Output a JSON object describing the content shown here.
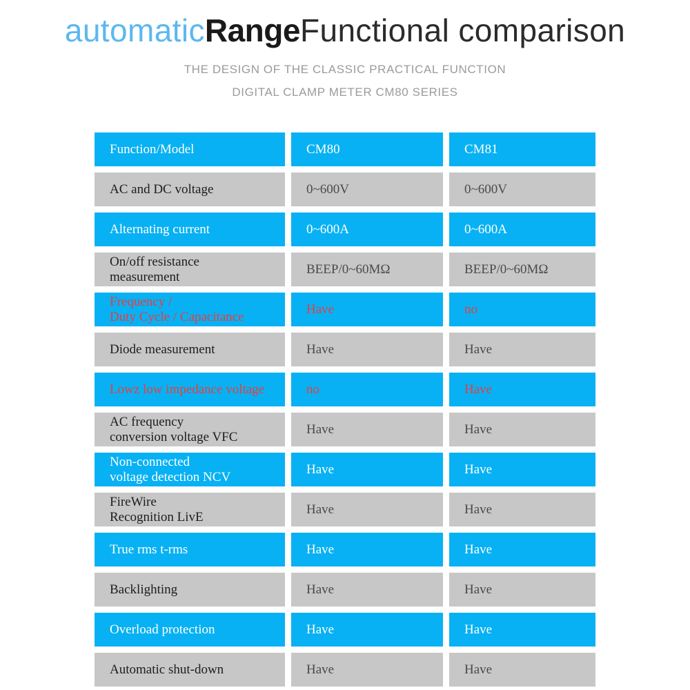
{
  "header": {
    "title_part1": "automatic",
    "title_part2": "Range",
    "title_part3": "Functional comparison",
    "subtitle_line1": "THE DESIGN OF THE CLASSIC PRACTICAL FUNCTION",
    "subtitle_line2": "DIGITAL CLAMP METER CM80 SERIES"
  },
  "colors": {
    "accent_blue": "#08b1f3",
    "title_blue": "#5bb8ef",
    "row_gray": "#c7c7c7",
    "highlight_red": "#ef3b3b",
    "subtitle_gray": "#9b9b9b"
  },
  "table": {
    "columns": [
      "Function/Model",
      "CM80",
      "CM81"
    ],
    "rows": [
      {
        "feature": "Function/Model",
        "cm80": "CM80",
        "cm81": "CM81",
        "style": "blue",
        "text": "white",
        "is_header": true
      },
      {
        "feature": "AC and DC voltage",
        "cm80": "0~600V",
        "cm81": "0~600V",
        "style": "gray",
        "text": "dark",
        "is_header": false
      },
      {
        "feature": "Alternating current",
        "cm80": "0~600A",
        "cm81": "0~600A",
        "style": "blue",
        "text": "white",
        "is_header": false
      },
      {
        "feature": "On/off resistance\nmeasurement",
        "cm80": "BEEP/0~60MΩ",
        "cm81": "BEEP/0~60MΩ",
        "style": "gray",
        "text": "dark",
        "is_header": false
      },
      {
        "feature": "Frequency /\nDuty Cycle / Capacitance",
        "cm80": "Have",
        "cm81": "no",
        "style": "blue",
        "text": "red",
        "is_header": false
      },
      {
        "feature": "Diode measurement",
        "cm80": "Have",
        "cm81": "Have",
        "style": "gray",
        "text": "dark",
        "is_header": false
      },
      {
        "feature": "Lowz low impedance voltage",
        "cm80": "no",
        "cm81": "Have",
        "style": "blue",
        "text": "red",
        "is_header": false
      },
      {
        "feature": "AC frequency\nconversion voltage VFC",
        "cm80": "Have",
        "cm81": "Have",
        "style": "gray",
        "text": "dark",
        "is_header": false
      },
      {
        "feature": "Non-connected\nvoltage detection NCV",
        "cm80": "Have",
        "cm81": "Have",
        "style": "blue",
        "text": "white",
        "is_header": false
      },
      {
        "feature": "FireWire\nRecognition LivE",
        "cm80": "Have",
        "cm81": "Have",
        "style": "gray",
        "text": "dark",
        "is_header": false
      },
      {
        "feature": "True rms t-rms",
        "cm80": "Have",
        "cm81": "Have",
        "style": "blue",
        "text": "white",
        "is_header": false
      },
      {
        "feature": "Backlighting",
        "cm80": "Have",
        "cm81": "Have",
        "style": "gray",
        "text": "dark",
        "is_header": false
      },
      {
        "feature": "Overload protection",
        "cm80": "Have",
        "cm81": "Have",
        "style": "blue",
        "text": "white",
        "is_header": false
      },
      {
        "feature": "Automatic shut-down",
        "cm80": "Have",
        "cm81": "Have",
        "style": "gray",
        "text": "dark",
        "is_header": false
      }
    ]
  }
}
